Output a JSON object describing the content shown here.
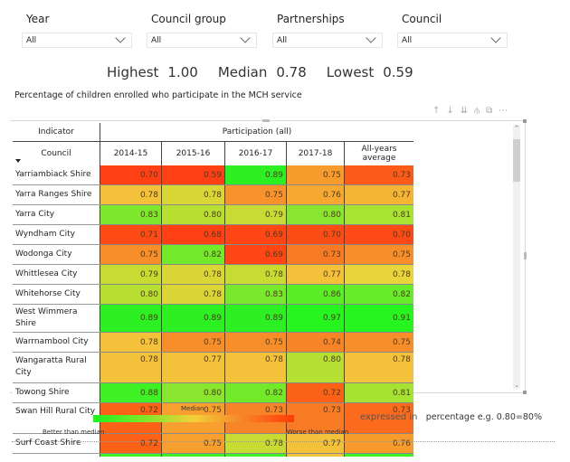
{
  "filters": [
    {
      "label": "Year",
      "value": "All"
    },
    {
      "label": "Council group",
      "value": "All"
    },
    {
      "label": "Partnerships",
      "value": "All"
    },
    {
      "label": "Council",
      "value": "All"
    }
  ],
  "kpis": {
    "highest_label": "Highest",
    "highest_value": "1.00",
    "median_label": "Median",
    "median_value": "0.78",
    "lowest_label": "Lowest",
    "lowest_value": "0.59"
  },
  "visual_title": "Percentage of children enrolled who participate in the MCH service",
  "toolbar": {
    "icons": [
      "sort-up-icon",
      "sort-down-icon",
      "expand-all-icon",
      "drill-down-icon",
      "focus-mode-icon",
      "more-options-icon"
    ],
    "glyphs": [
      "↑",
      "↓",
      "⇊",
      "⫛",
      "⧉",
      "⋯"
    ]
  },
  "table": {
    "row_header_label": "Indicator",
    "row_field_label": "Council",
    "column_group_label": "Participation (all)",
    "columns": [
      "2014-15",
      "2015-16",
      "2016-17",
      "2017-18",
      "All-years average"
    ],
    "rows": [
      {
        "council": "Yarriambiack Shire",
        "values": [
          "0.70",
          "0.59",
          "0.89",
          "0.75",
          "0.73"
        ],
        "colors": [
          "#ff4014",
          "#ff4014",
          "#2df022",
          "#f79b2c",
          "#fc5a18"
        ]
      },
      {
        "council": "Yarra Ranges Shire",
        "values": [
          "0.78",
          "0.78",
          "0.75",
          "0.76",
          "0.77"
        ],
        "colors": [
          "#f4c23a",
          "#d9d736",
          "#f8922a",
          "#f7a830",
          "#f5b534"
        ]
      },
      {
        "council": "Yarra City",
        "values": [
          "0.83",
          "0.80",
          "0.79",
          "0.80",
          "0.81"
        ],
        "colors": [
          "#7de82c",
          "#b8e032",
          "#c6dc34",
          "#8ae52e",
          "#a8e232"
        ]
      },
      {
        "council": "Wyndham City",
        "values": [
          "0.71",
          "0.68",
          "0.69",
          "0.70",
          "0.70"
        ],
        "colors": [
          "#fe4a14",
          "#ff4014",
          "#ff4614",
          "#fc4c16",
          "#fd4a16"
        ]
      },
      {
        "council": "Wodonga City",
        "values": [
          "0.75",
          "0.82",
          "0.69",
          "0.73",
          "0.75"
        ],
        "colors": [
          "#f78e2a",
          "#72ea2a",
          "#ff4614",
          "#f97a24",
          "#f78e2a"
        ]
      },
      {
        "council": "Whittlesea City",
        "values": [
          "0.79",
          "0.78",
          "0.78",
          "0.77",
          "0.78"
        ],
        "colors": [
          "#c8db32",
          "#dad636",
          "#c8db32",
          "#f4c23a",
          "#e9d53a"
        ]
      },
      {
        "council": "Whitehorse City",
        "values": [
          "0.80",
          "0.78",
          "0.83",
          "0.86",
          "0.82"
        ],
        "colors": [
          "#b8e032",
          "#dad636",
          "#78e92c",
          "#5aee26",
          "#68eb28"
        ]
      },
      {
        "council": "West Wimmera Shire",
        "values": [
          "0.89",
          "0.89",
          "0.89",
          "0.97",
          "0.91"
        ],
        "colors": [
          "#2df022",
          "#2df022",
          "#2df022",
          "#26f520",
          "#26f520"
        ]
      },
      {
        "council": "Warrnambool City",
        "values": [
          "0.78",
          "0.75",
          "0.75",
          "0.74",
          "0.75"
        ],
        "colors": [
          "#f4c23a",
          "#f78e2a",
          "#f78e2a",
          "#f88428",
          "#f88e2a"
        ]
      },
      {
        "council": "Wangaratta Rural City",
        "values": [
          "0.78",
          "0.77",
          "0.78",
          "0.80",
          "0.78"
        ],
        "colors": [
          "#f4c23a",
          "#f4c23a",
          "#f4c23a",
          "#b5df32",
          "#f4c23a"
        ]
      },
      {
        "council": "Towong Shire",
        "values": [
          "0.88",
          "0.80",
          "0.82",
          "0.72",
          "0.81"
        ],
        "colors": [
          "#3ef024",
          "#8ae52e",
          "#72ea2a",
          "#fc6118",
          "#a5e232"
        ]
      },
      {
        "council": "Swan Hill Rural City",
        "values": [
          "0.72",
          "0.75",
          "0.73",
          "0.73",
          "0.73"
        ],
        "colors": [
          "#fc6118",
          "#f7a030",
          "#f88428",
          "#f97a24",
          "#fc6a1e"
        ]
      },
      {
        "council": "Surf Coast Shire",
        "values": [
          "0.72",
          "0.75",
          "0.78",
          "0.77",
          "0.76"
        ],
        "colors": [
          "#fc6118",
          "#f7a030",
          "#c8db32",
          "#f4c23a",
          "#f79b2c"
        ]
      }
    ],
    "partial_row_colors": [
      "#3ef024",
      "#3ef024",
      "#3ef024",
      "#f4c23a",
      "#3ef024"
    ]
  },
  "legend": {
    "title": "Median",
    "better_label": "Better than median",
    "worse_label": "Worse than median",
    "gradient_colors": [
      "#1ef21e",
      "#f4cf3a",
      "#ff3b0a"
    ]
  },
  "expressed": {
    "label": "expressed in",
    "unit": "percentage e.g. 0.80=80%"
  }
}
